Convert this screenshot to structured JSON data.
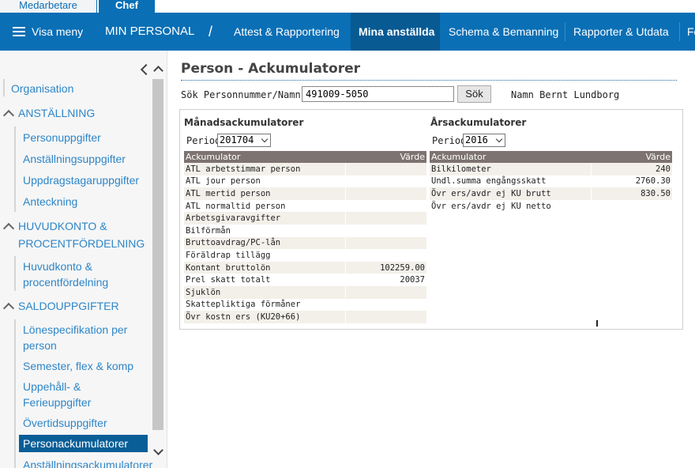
{
  "role_tabs": {
    "inactive": "Medarbetare",
    "active": "Chef"
  },
  "navbar": {
    "menu": "Visa meny",
    "app": "MIN PERSONAL",
    "slash": "/",
    "items": [
      "Attest & Rapportering",
      "Mina anställda",
      "Schema & Bemanning",
      "Rapporter & Utdata",
      "Fö"
    ]
  },
  "sidebar": {
    "organisation": "Organisation",
    "sections": [
      {
        "title": "ANSTÄLLNING",
        "items": [
          "Personuppgifter",
          "Anställningsuppgifter",
          "Uppdragstagaruppgifter",
          "Anteckning"
        ]
      },
      {
        "title_line1": "HUVUDKONTO &",
        "title_line2": "PROCENTFÖRDELNING",
        "item_line1": "Huvudkonto &",
        "item_line2": "procentfördelning"
      },
      {
        "title": "SALDOUPPGIFTER",
        "items": [
          {
            "l1": "Lönespecifikation per",
            "l2": "person"
          },
          {
            "l1": "Semester, flex & komp"
          },
          {
            "l1": "Uppehåll- &",
            "l2": "Ferieuppgifter"
          },
          {
            "l1": "Övertidsuppgifter"
          },
          {
            "l1": "Personackumulatorer"
          },
          {
            "l1": "Anställningsackumulatorer"
          }
        ]
      }
    ]
  },
  "main": {
    "title": "Person - Ackumulatorer",
    "search_label": "Sök Personnummer/Namn",
    "search_value": "491009-5050",
    "search_button": "Sök",
    "name_text": "Namn Bernt Lundborg",
    "monthly": {
      "title": "Månadsackumulatorer",
      "period_label": "Period",
      "period_value": "201704",
      "col_key": "Ackumulator",
      "col_val": "Värde",
      "rows": [
        [
          "ATL arbetstimmar person",
          ""
        ],
        [
          "ATL jour person",
          ""
        ],
        [
          "ATL mertid person",
          ""
        ],
        [
          "ATL normaltid person",
          ""
        ],
        [
          "Arbetsgivaravgifter",
          ""
        ],
        [
          "Bilförmån",
          ""
        ],
        [
          "Bruttoavdrag/PC-lån",
          ""
        ],
        [
          "Föräldrap tillägg",
          ""
        ],
        [
          "Kontant bruttolön",
          "102259.00"
        ],
        [
          "Prel skatt totalt",
          "20037"
        ],
        [
          "Sjuklön",
          ""
        ],
        [
          "Skattepliktiga förmåner",
          ""
        ],
        [
          "Övr kostn ers (KU20+66)",
          ""
        ]
      ]
    },
    "yearly": {
      "title": "Årsackumulatorer",
      "period_label": "Period",
      "period_value": "2016",
      "col_key": "Ackumulator",
      "col_val": "Värde",
      "rows": [
        [
          "Bilkilometer",
          "240"
        ],
        [
          "Undl.summa engångsskatt",
          "2760.30"
        ],
        [
          "Övr ers/avdr ej KU brutt",
          "830.50"
        ],
        [
          "Övr ers/avdr ej KU netto",
          ""
        ]
      ]
    }
  }
}
